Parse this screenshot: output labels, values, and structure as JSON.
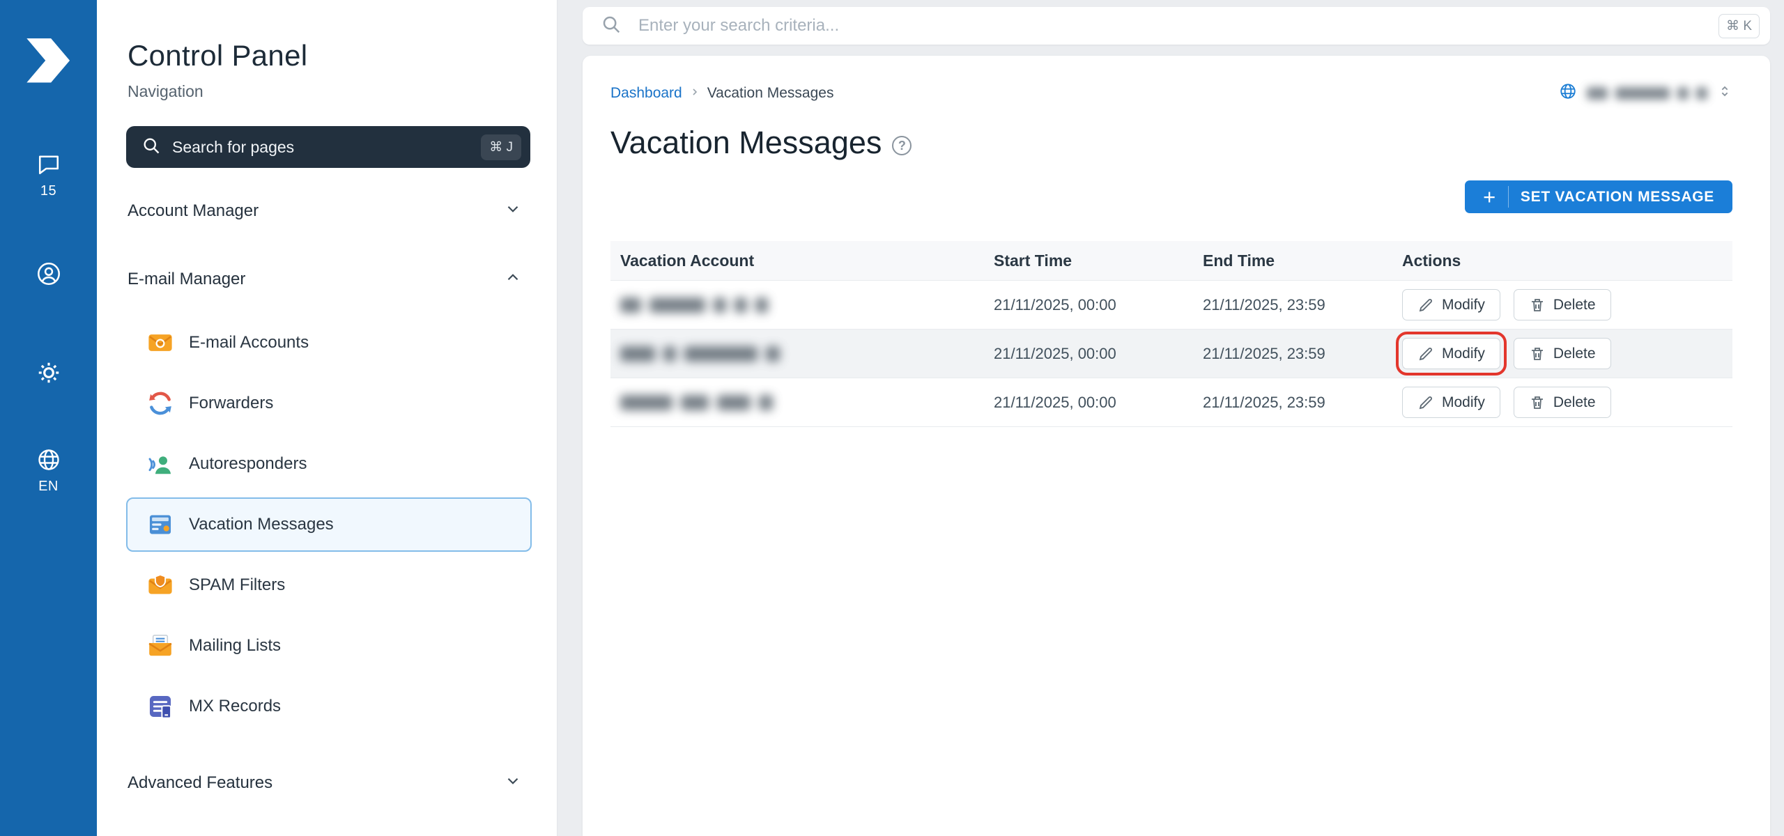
{
  "colors": {
    "rail_bg": "#1566ac",
    "accent_blue": "#1b7ed8",
    "link_blue": "#1a73c8",
    "selected_item_border": "#83bce9",
    "annotation_red": "#e3362c"
  },
  "rail": {
    "badge_count": "15",
    "language_label": "EN"
  },
  "sidebar": {
    "title": "Control Panel",
    "subtitle": "Navigation",
    "search_label": "Search for pages",
    "search_shortcut": "⌘ J",
    "sections": {
      "account_manager": "Account Manager",
      "email_manager": "E-mail Manager",
      "advanced_features": "Advanced Features"
    },
    "email_items": [
      {
        "label": "E-mail Accounts",
        "icon": "email-accounts-icon",
        "selected": false
      },
      {
        "label": "Forwarders",
        "icon": "forwarders-icon",
        "selected": false
      },
      {
        "label": "Autoresponders",
        "icon": "autoresponders-icon",
        "selected": false
      },
      {
        "label": "Vacation Messages",
        "icon": "vacation-messages-icon",
        "selected": true
      },
      {
        "label": "SPAM Filters",
        "icon": "spam-filters-icon",
        "selected": false
      },
      {
        "label": "Mailing Lists",
        "icon": "mailing-lists-icon",
        "selected": false
      },
      {
        "label": "MX Records",
        "icon": "mx-records-icon",
        "selected": false
      }
    ]
  },
  "topbar": {
    "search_placeholder": "Enter your search criteria...",
    "search_shortcut": "⌘ K"
  },
  "glyphs": {
    "help": "?",
    "plus": "+"
  },
  "main": {
    "breadcrumb": {
      "home": "Dashboard",
      "current": "Vacation Messages"
    },
    "title": "Vacation Messages",
    "add_button_label": "SET VACATION MESSAGE",
    "domain_selector_redacted": true,
    "table": {
      "headers": [
        "Vacation Account",
        "Start Time",
        "End Time",
        "Actions"
      ],
      "modify_label": "Modify",
      "delete_label": "Delete",
      "rows": [
        {
          "account_redacted": true,
          "start_time": "21/11/2025, 00:00",
          "end_time": "21/11/2025, 23:59",
          "modify_annotated": false,
          "hovered": false
        },
        {
          "account_redacted": true,
          "start_time": "21/11/2025, 00:00",
          "end_time": "21/11/2025, 23:59",
          "modify_annotated": true,
          "hovered": true
        },
        {
          "account_redacted": true,
          "start_time": "21/11/2025, 00:00",
          "end_time": "21/11/2025, 23:59",
          "modify_annotated": false,
          "hovered": false
        }
      ]
    }
  }
}
